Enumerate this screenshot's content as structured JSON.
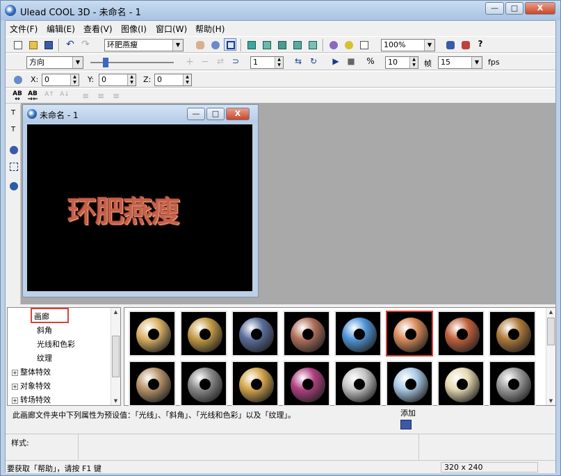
{
  "window": {
    "title": "Ulead COOL 3D - 未命名 - 1",
    "minimize": "—",
    "maximize": "□",
    "close": "X"
  },
  "menu": [
    "文件(F)",
    "编辑(E)",
    "查看(V)",
    "图像(I)",
    "窗口(W)",
    "帮助(H)"
  ],
  "toolbar": {
    "text_select": "环肥燕瘦",
    "zoom": "100%",
    "direction": "方向",
    "frame_value": "1",
    "frame_count": "10",
    "frame_label": "帧",
    "fps_value": "15",
    "fps_label": "fps",
    "x_label": "X:",
    "x_value": "0",
    "y_label": "Y:",
    "y_value": "0",
    "z_label": "Z:",
    "z_value": "0"
  },
  "document": {
    "title": "未命名 - 1",
    "artwork_text": "环肥燕瘦"
  },
  "tree": {
    "items": [
      {
        "label": "画廊",
        "expander": ""
      },
      {
        "label": "斜角",
        "expander": ""
      },
      {
        "label": "光线和色彩",
        "expander": ""
      },
      {
        "label": "纹理",
        "expander": ""
      },
      {
        "label": "整体特效",
        "expander": "+"
      },
      {
        "label": "对象特效",
        "expander": "+"
      },
      {
        "label": "转场特效",
        "expander": "+"
      }
    ]
  },
  "gallery": {
    "items": [
      {
        "name": "gallery-gold-ring",
        "color": "#d9b064"
      },
      {
        "name": "gallery-gold-chrome-ring",
        "color": "#c49a44"
      },
      {
        "name": "gallery-blue-steel-ring",
        "color": "#5a6e9c"
      },
      {
        "name": "gallery-copper-ring",
        "color": "#b0705a"
      },
      {
        "name": "gallery-blue-ice-ring",
        "color": "#4f95d8"
      },
      {
        "name": "gallery-orange-selected-ring",
        "color": "#d88a5a"
      },
      {
        "name": "gallery-brick-ring",
        "color": "#c0603a"
      },
      {
        "name": "gallery-bronze-ring",
        "color": "#b07a3a"
      },
      {
        "name": "gallery-cork-ring",
        "color": "#b8946a"
      },
      {
        "name": "gallery-film-ring",
        "color": "#8a8a8a"
      },
      {
        "name": "gallery-dotted-ring",
        "color": "#d4a54a"
      },
      {
        "name": "gallery-stained-glass-ring",
        "color": "#b04080"
      },
      {
        "name": "gallery-silver-ring",
        "color": "#c4c4c4"
      },
      {
        "name": "gallery-glass-ring",
        "color": "#a8c8e4"
      },
      {
        "name": "gallery-white-gold-ring",
        "color": "#e4d8b0"
      },
      {
        "name": "gallery-metal-bolt-ring",
        "color": "#9a9a9a"
      }
    ]
  },
  "description": "此画廊文件夹中下列属性为预设值：「光线」、「斜角」、「光线和色彩」以及「纹理」。",
  "add_label": "添加",
  "style_label": "样式:",
  "status": {
    "help": "要获取「帮助」，请按 F1 键",
    "size": "320 x 240"
  },
  "colors": {
    "highlight": "#d9403a",
    "canvas": "#000000",
    "artwork": "#c5614a"
  }
}
